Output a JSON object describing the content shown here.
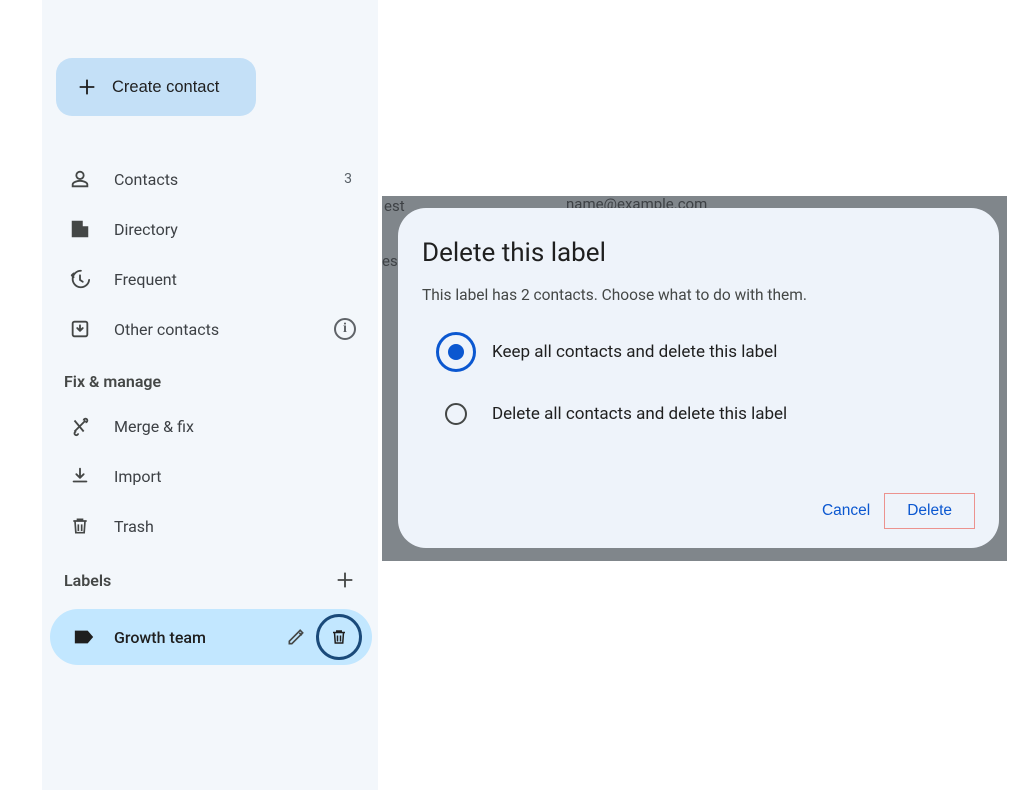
{
  "sidebar": {
    "create_label": "Create contact",
    "items": [
      {
        "label": "Contacts",
        "count": "3"
      },
      {
        "label": "Directory"
      },
      {
        "label": "Frequent"
      },
      {
        "label": "Other contacts"
      }
    ],
    "fix_manage_header": "Fix & manage",
    "fix_items": [
      {
        "label": "Merge & fix"
      },
      {
        "label": "Import"
      },
      {
        "label": "Trash"
      }
    ],
    "labels_header": "Labels",
    "labels": [
      {
        "name": "Growth team"
      }
    ]
  },
  "stray": {
    "est1": "est",
    "est2": "es",
    "email": "name@example.com"
  },
  "dialog": {
    "title": "Delete this label",
    "subtitle": "This label has 2 contacts. Choose what to do with them.",
    "option_keep": "Keep all contacts and delete this label",
    "option_delete": "Delete all contacts and delete this label",
    "cancel": "Cancel",
    "delete": "Delete"
  }
}
